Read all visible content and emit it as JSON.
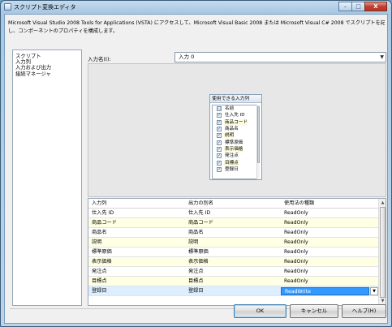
{
  "window": {
    "title": "スクリプト変換エディタ",
    "minimize_glyph": "–",
    "maximize_glyph": "□",
    "close_glyph": "X"
  },
  "description": {
    "line1": "Microsoft Visual Studio 2008 Tools for Applications (VSTA) にアクセスして、Microsoft Visual Basic 2008 または Microsoft Visual C# 2008 でスクリプトを記述",
    "line2": "し、コンポーネントのプロパティを構成します。"
  },
  "nav": {
    "items": [
      {
        "label": "スクリプト"
      },
      {
        "label": "入力列"
      },
      {
        "label": "入力および出力"
      },
      {
        "label": "接続マネージャ"
      }
    ]
  },
  "input": {
    "label": "入力名(I):",
    "selected": "入力 0",
    "dropdown_glyph": "▼"
  },
  "column_picker": {
    "title": "使用できる入力列",
    "header_check": "☐",
    "header_name": "名前",
    "check_glyph": "✓",
    "rows": [
      {
        "name": "仕入先 ID"
      },
      {
        "name": "商品コード"
      },
      {
        "name": "商品名"
      },
      {
        "name": "説明"
      },
      {
        "name": "標準原価"
      },
      {
        "name": "表示価格"
      },
      {
        "name": "発注点"
      },
      {
        "name": "目標点"
      },
      {
        "name": "登録日"
      }
    ]
  },
  "grid": {
    "headers": {
      "input_column": "入力列",
      "output_alias": "出力の別名",
      "usage_type": "使用法の種類"
    },
    "rows": [
      {
        "input": "仕入先 ID",
        "alias": "仕入先 ID",
        "usage": "ReadOnly"
      },
      {
        "input": "商品コード",
        "alias": "商品コード",
        "usage": "ReadOnly"
      },
      {
        "input": "商品名",
        "alias": "商品名",
        "usage": "ReadOnly"
      },
      {
        "input": "説明",
        "alias": "説明",
        "usage": "ReadOnly"
      },
      {
        "input": "標準原価",
        "alias": "標準原価",
        "usage": "ReadOnly"
      },
      {
        "input": "表示価格",
        "alias": "表示価格",
        "usage": "ReadOnly"
      },
      {
        "input": "発注点",
        "alias": "発注点",
        "usage": "ReadOnly"
      },
      {
        "input": "目標点",
        "alias": "目標点",
        "usage": "ReadOnly"
      }
    ],
    "selected_row": {
      "input": "登録日",
      "alias": "登録日",
      "usage": "ReadWrite"
    },
    "scroll_up_glyph": "▲",
    "scroll_down_glyph": "▼"
  },
  "buttons": {
    "ok": "OK",
    "cancel": "キャンセル",
    "help": "ヘルプ(H)"
  },
  "colors": {
    "selection": "#3399ff",
    "row_alt": "#ffffe3",
    "titlebar": "#a9c8e2"
  }
}
